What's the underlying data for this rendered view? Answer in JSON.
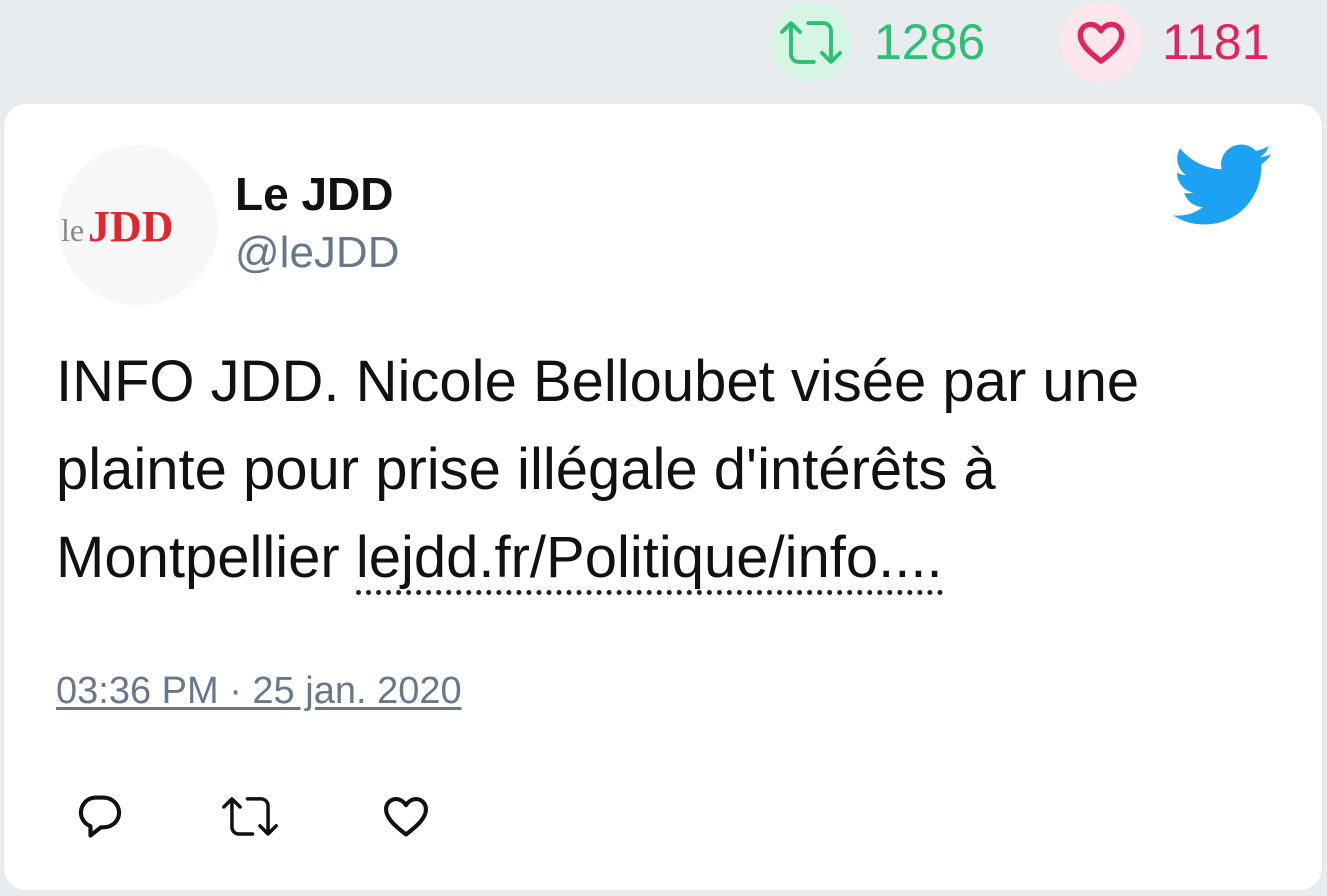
{
  "stats": {
    "retweet_count": "1286",
    "like_count": "1181",
    "retweet_color": "#2bbf77",
    "like_color": "#e0245e"
  },
  "tweet": {
    "avatar_icon": "le-jdd-logo",
    "avatar_logo_text": "leJDD",
    "display_name": "Le JDD",
    "handle": "@leJDD",
    "text": "INFO JDD. Nicole Belloubet visée par une plainte pour prise illégale d'intérêts à Montpellier",
    "link_text": "lejdd.fr/Politique/info....",
    "timestamp": "03:36 PM · 25 jan. 2020",
    "platform_icon": "twitter-bird-icon",
    "platform_color": "#1da1f2"
  },
  "actions": [
    {
      "icon": "reply-icon"
    },
    {
      "icon": "retweet-icon"
    },
    {
      "icon": "like-icon"
    }
  ]
}
